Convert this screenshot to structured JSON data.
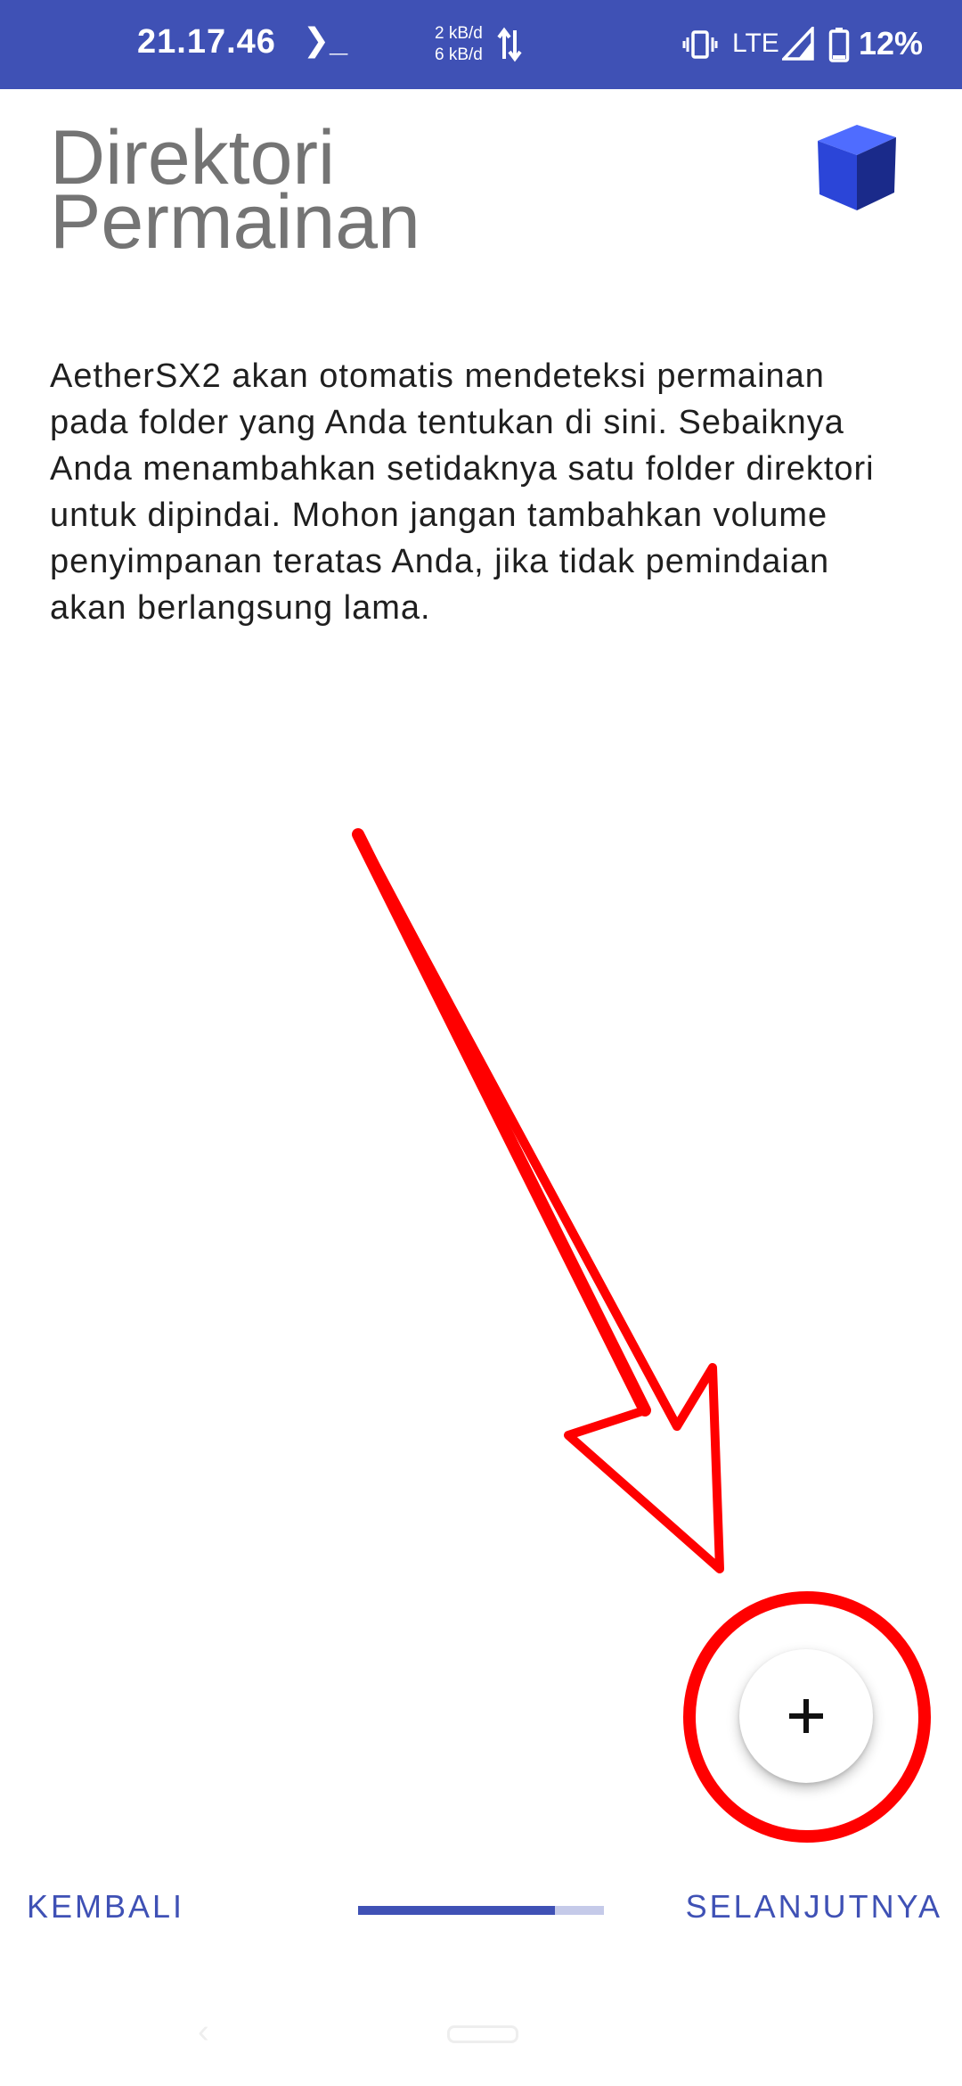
{
  "status_bar": {
    "time": "21.17.46",
    "terminal_glyph": "❯_",
    "net_up": "2 kB/d",
    "net_down": "6 kB/d",
    "network_type": "LTE",
    "battery": "12%",
    "background_color": "#3f51b5"
  },
  "header": {
    "title_line1": "Direktori",
    "title_line2": "Permainan",
    "logo_icon": "blue-cube-icon"
  },
  "description": "AetherSX2 akan otomatis mendeteksi permainan pada folder yang Anda tentukan di sini. Sebaiknya Anda menambahkan setidaknya satu folder direktori untuk dipindai. Mohon jangan tambahkan volume penyimpanan teratas Anda, jika tidak pemindaian akan berlangsung lama.",
  "fab": {
    "icon": "plus-icon",
    "label": "+"
  },
  "annotation": {
    "color": "#ff0000",
    "arrow_icon": "red-arrow-annotation",
    "circle_icon": "red-circle-annotation"
  },
  "footer": {
    "back_label": "KEMBALI",
    "next_label": "SELANJUTNYA",
    "progress_fraction": 0.8,
    "accent_color": "#3f51b5"
  },
  "system_nav": {
    "back_icon": "back-chevron-icon",
    "home_icon": "home-pill-icon"
  }
}
